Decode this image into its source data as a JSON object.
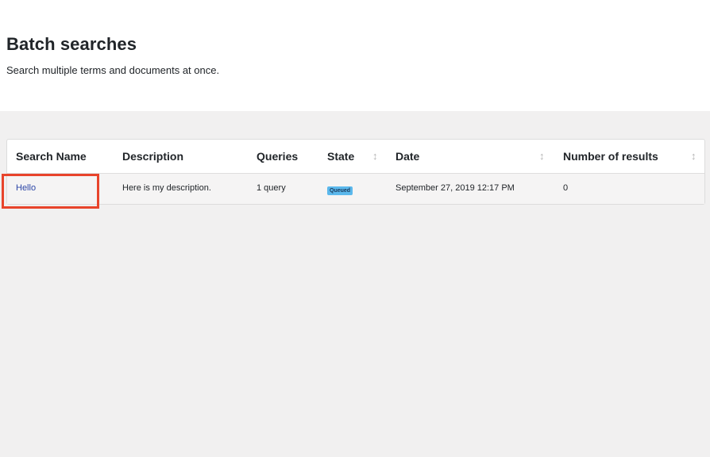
{
  "header": {
    "title": "Batch searches",
    "subtitle": "Search multiple terms and documents at once."
  },
  "table": {
    "columns": [
      {
        "key": "name",
        "label": "Search Name",
        "sortable": false
      },
      {
        "key": "description",
        "label": "Description",
        "sortable": false
      },
      {
        "key": "queries",
        "label": "Queries",
        "sortable": false
      },
      {
        "key": "state",
        "label": "State",
        "sortable": true
      },
      {
        "key": "date",
        "label": "Date",
        "sortable": true
      },
      {
        "key": "results",
        "label": "Number of results",
        "sortable": true
      }
    ],
    "rows": [
      {
        "name": "Hello",
        "description": "Here is my description.",
        "queries": "1 query",
        "state": "Queued",
        "date": "September 27, 2019 12:17 PM",
        "results": "0"
      }
    ]
  },
  "icons": {
    "sort": "sort-arrows-icon"
  },
  "colors": {
    "link": "#2b45a6",
    "badge_queued": "#5bb8ec",
    "highlight": "#e8442b"
  }
}
